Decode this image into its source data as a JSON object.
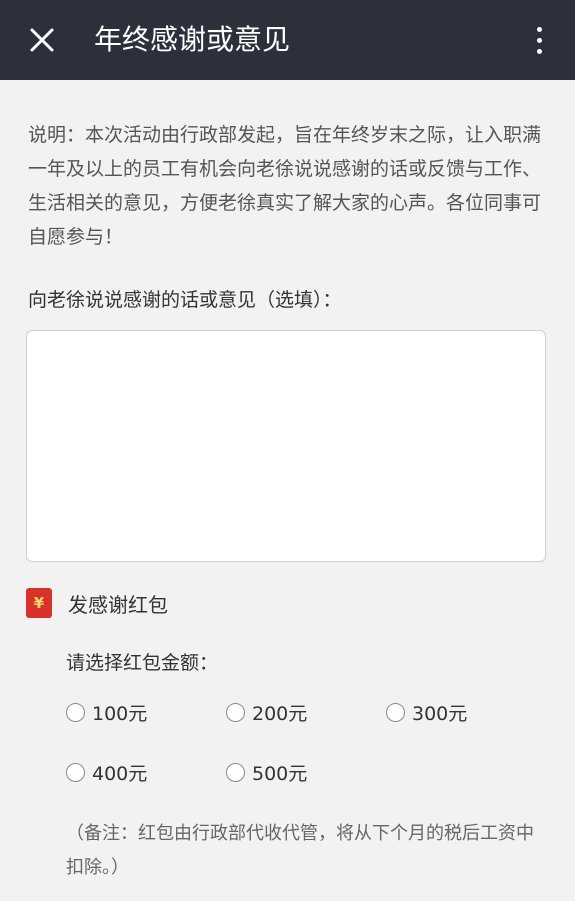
{
  "header": {
    "title": "年终感谢或意见",
    "close_icon": "close-icon",
    "more_icon": "more-vertical-icon",
    "background": "#2b303b"
  },
  "description": "说明：本次活动由行政部发起，旨在年终岁末之际，让入职满一年及以上的员工有机会向老徐说说感谢的话或反馈与工作、生活相关的意见，方便老徐真实了解大家的心声。各位同事可自愿参与！",
  "message": {
    "label": "向老徐说说感谢的话或意见（选填）：",
    "value": "",
    "placeholder": ""
  },
  "red_packet": {
    "label": "发感谢红包",
    "icon": "red-packet-icon",
    "icon_glyph": "¥",
    "icon_color": "#d9322b",
    "amount_label": "请选择红包金额：",
    "options": [
      "100元",
      "200元",
      "300元",
      "400元",
      "500元"
    ],
    "note": "（备注：红包由行政部代收代管，将从下个月的税后工资中扣除。）"
  }
}
